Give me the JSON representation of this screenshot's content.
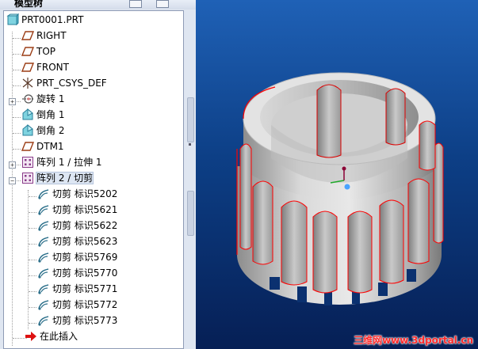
{
  "panel": {
    "title": "模型树"
  },
  "tree": {
    "items": [
      {
        "label": "PRT0001.PRT",
        "icon": "part-icon"
      },
      {
        "label": "RIGHT",
        "icon": "datum-plane-icon"
      },
      {
        "label": "TOP",
        "icon": "datum-plane-icon"
      },
      {
        "label": "FRONT",
        "icon": "datum-plane-icon"
      },
      {
        "label": "PRT_CSYS_DEF",
        "icon": "coordinate-system-icon"
      },
      {
        "label": "旋转 1",
        "icon": "revolve-icon"
      },
      {
        "label": "倒角 1",
        "icon": "chamfer-icon"
      },
      {
        "label": "倒角 2",
        "icon": "chamfer-icon"
      },
      {
        "label": "DTM1",
        "icon": "datum-plane-icon"
      },
      {
        "label": "阵列 1 / 拉伸 1",
        "icon": "pattern-icon"
      },
      {
        "label": "阵列 2 / 切剪",
        "icon": "pattern-icon"
      },
      {
        "label": "切剪 标识5202",
        "icon": "cut-icon"
      },
      {
        "label": "切剪 标识5621",
        "icon": "cut-icon"
      },
      {
        "label": "切剪 标识5622",
        "icon": "cut-icon"
      },
      {
        "label": "切剪 标识5623",
        "icon": "cut-icon"
      },
      {
        "label": "切剪 标识5769",
        "icon": "cut-icon"
      },
      {
        "label": "切剪 标识5770",
        "icon": "cut-icon"
      },
      {
        "label": "切剪 标识5771",
        "icon": "cut-icon"
      },
      {
        "label": "切剪 标识5772",
        "icon": "cut-icon"
      },
      {
        "label": "切剪 标识5773",
        "icon": "cut-icon"
      },
      {
        "label": "在此插入",
        "icon": "insert-here-arrow-icon"
      }
    ]
  },
  "viewport": {
    "watermark": "三维网www.3dportal.cn",
    "colors": {
      "background_top": "#1f61b6",
      "background_bottom": "#061f55",
      "model": "#c8c8c8",
      "edge_highlight": "#ff0000"
    }
  }
}
